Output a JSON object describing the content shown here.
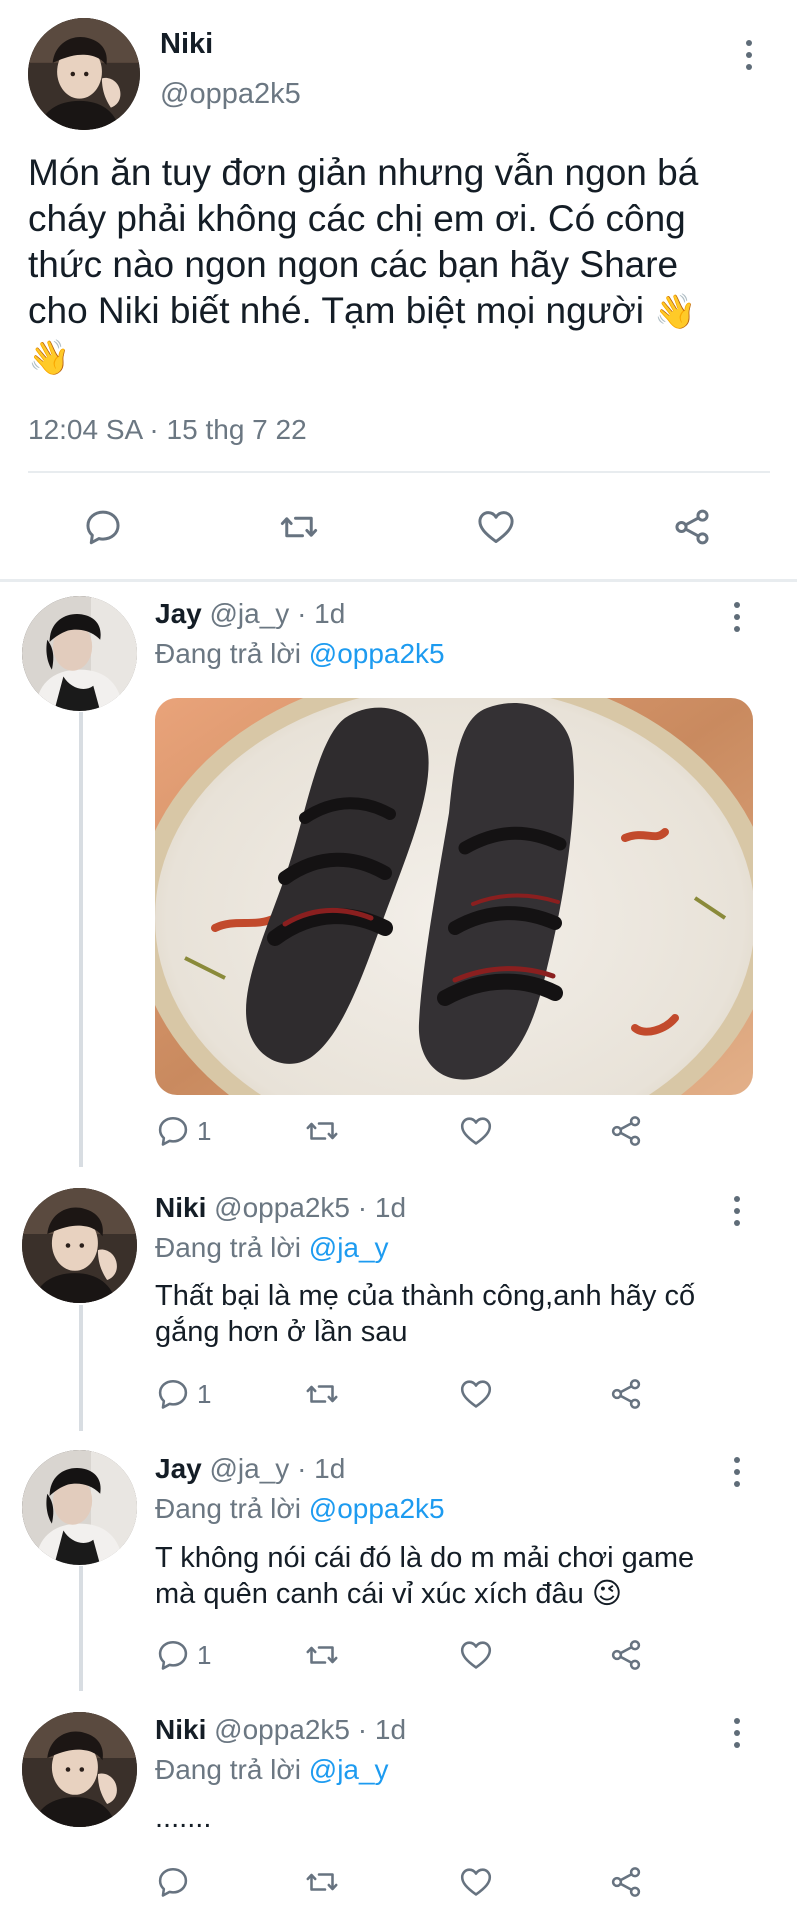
{
  "main_tweet": {
    "author_name": "Niki",
    "handle": "@oppa2k5",
    "text_line1": "Món ăn tuy đơn giản nhưng vẫn ngon bá",
    "text_line2": "cháy phải không các chị em ơi. Có công",
    "text_line3": "thức nào ngon ngon các bạn hãy Share",
    "text_line4": "cho Niki biết nhé. Tạm biệt mọi người",
    "emoji": "👋",
    "timestamp": "12:04 SA · 15 thg 7 22"
  },
  "replies": [
    {
      "author_name": "Jay",
      "handle_time": "@ja_y · 1d",
      "replying_prefix": "Đang trả lời",
      "replying_to": "@oppa2k5",
      "reply_count": "1",
      "has_image": true
    },
    {
      "author_name": "Niki",
      "handle_time": "@oppa2k5 · 1d",
      "replying_prefix": "Đang trả lời",
      "replying_to": "@ja_y",
      "text_line1": "Thất bại là mẹ của thành công,anh hãy cố",
      "text_line2": "gắng hơn ở lần sau",
      "reply_count": "1"
    },
    {
      "author_name": "Jay",
      "handle_time": "@ja_y · 1d",
      "replying_prefix": "Đang trả lời",
      "replying_to": "@oppa2k5",
      "text_line1": "T không nói cái đó là do m mải chơi game",
      "text_line2": "mà quên canh cái vỉ xúc xích đâu",
      "emoji": "😉",
      "reply_count": "1"
    },
    {
      "author_name": "Niki",
      "handle_time": "@oppa2k5 · 1d",
      "replying_prefix": "Đang trả lời",
      "replying_to": "@ja_y",
      "text_line1": ".......",
      "reply_count": ""
    }
  ],
  "colors": {
    "link": "#1d9bf0",
    "secondary_text": "#6b7782",
    "primary_text": "#141d26",
    "divider": "#e8ecef"
  },
  "icons": [
    "reply-icon",
    "retweet-icon",
    "like-icon",
    "share-icon",
    "more-options-icon"
  ]
}
